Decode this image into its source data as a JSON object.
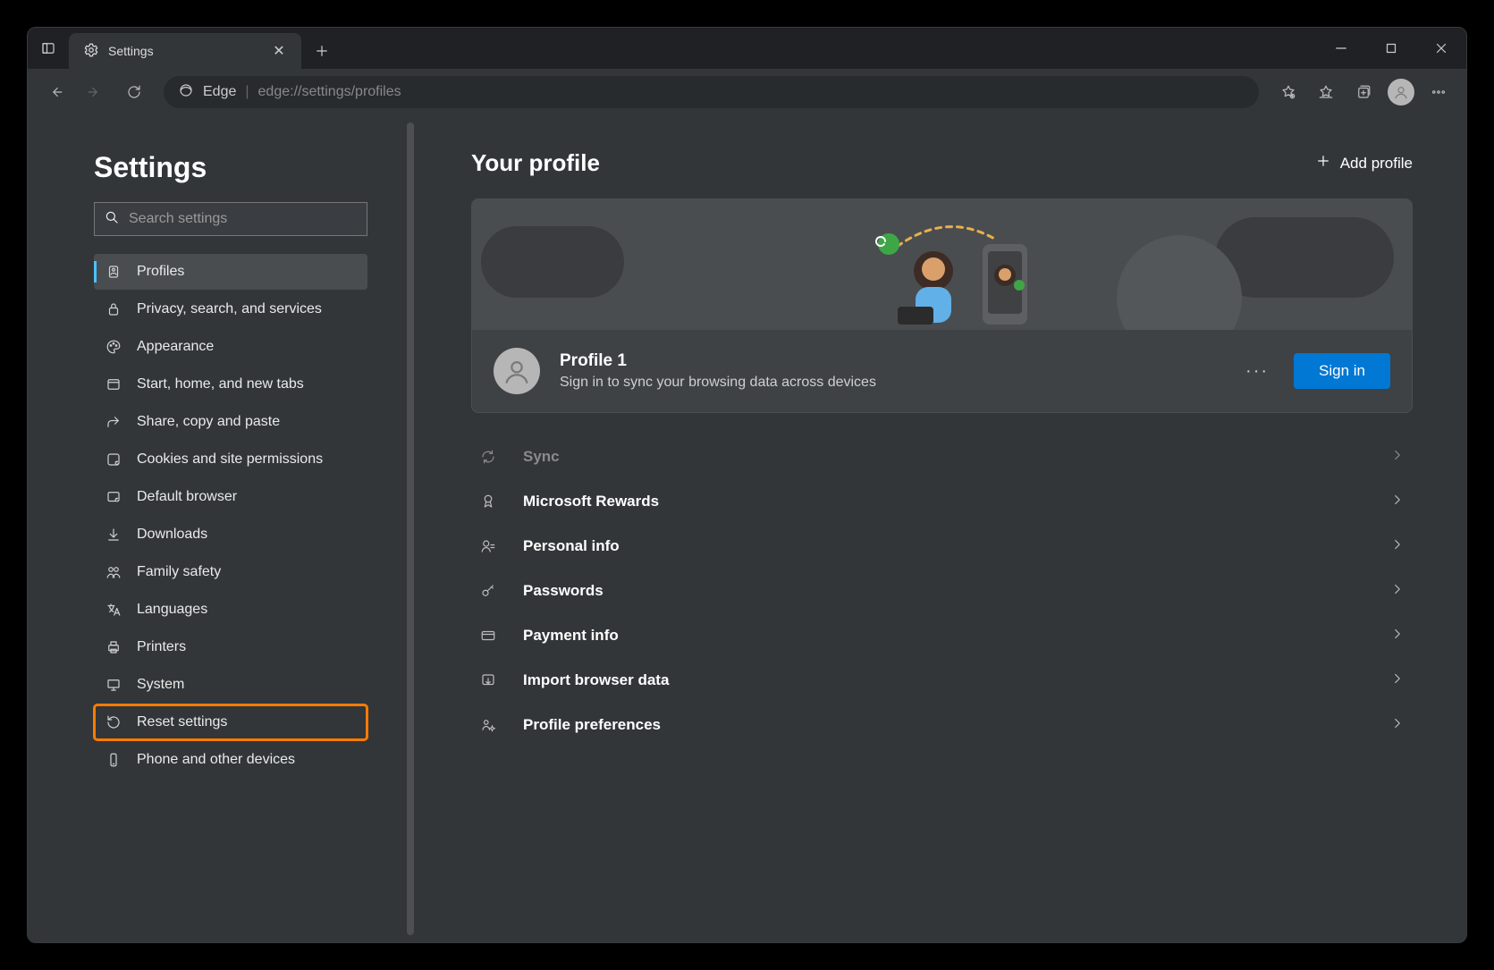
{
  "titlebar": {
    "tab_label": "Settings"
  },
  "addressbar": {
    "scheme_label": "Edge",
    "url": "edge://settings/profiles"
  },
  "sidebar": {
    "heading": "Settings",
    "search_placeholder": "Search settings",
    "items": [
      {
        "label": "Profiles"
      },
      {
        "label": "Privacy, search, and services"
      },
      {
        "label": "Appearance"
      },
      {
        "label": "Start, home, and new tabs"
      },
      {
        "label": "Share, copy and paste"
      },
      {
        "label": "Cookies and site permissions"
      },
      {
        "label": "Default browser"
      },
      {
        "label": "Downloads"
      },
      {
        "label": "Family safety"
      },
      {
        "label": "Languages"
      },
      {
        "label": "Printers"
      },
      {
        "label": "System"
      },
      {
        "label": "Reset settings"
      },
      {
        "label": "Phone and other devices"
      }
    ]
  },
  "main": {
    "heading": "Your profile",
    "add_profile_label": "Add profile",
    "profile": {
      "name": "Profile 1",
      "desc": "Sign in to sync your browsing data across devices",
      "more_label": "···",
      "signin_label": "Sign in"
    },
    "settings": [
      {
        "label": "Sync",
        "disabled": true,
        "icon": "sync"
      },
      {
        "label": "Microsoft Rewards",
        "icon": "rewards"
      },
      {
        "label": "Personal info",
        "icon": "person"
      },
      {
        "label": "Passwords",
        "icon": "key"
      },
      {
        "label": "Payment info",
        "icon": "card"
      },
      {
        "label": "Import browser data",
        "icon": "import"
      },
      {
        "label": "Profile preferences",
        "icon": "prefs"
      }
    ]
  }
}
